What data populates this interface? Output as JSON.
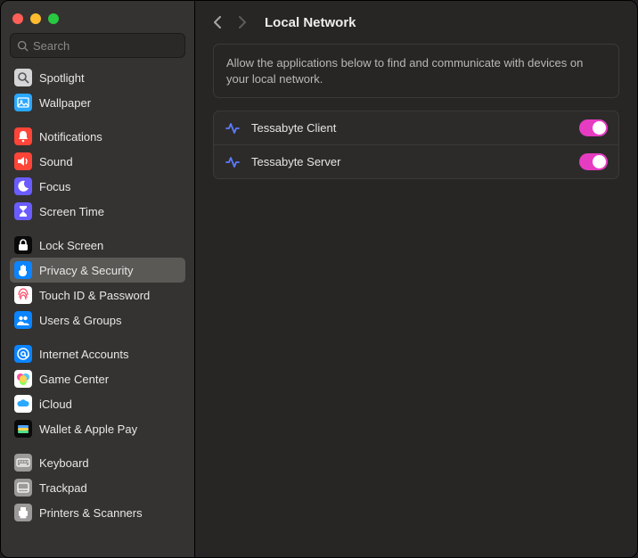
{
  "search": {
    "placeholder": "Search"
  },
  "sidebar": {
    "items": [
      {
        "label": "Spotlight",
        "icon": "spotlight",
        "bg": "#d5d5d8",
        "fg": "#555"
      },
      {
        "label": "Wallpaper",
        "icon": "wallpaper",
        "bg": "#2aa8ff",
        "fg": "#fff"
      },
      {
        "label": "Notifications",
        "icon": "bell",
        "bg": "#ff4438",
        "fg": "#fff"
      },
      {
        "label": "Sound",
        "icon": "sound",
        "bg": "#ff4438",
        "fg": "#fff"
      },
      {
        "label": "Focus",
        "icon": "moon",
        "bg": "#6a5cff",
        "fg": "#fff"
      },
      {
        "label": "Screen Time",
        "icon": "hourglass",
        "bg": "#6a5cff",
        "fg": "#fff"
      },
      {
        "label": "Lock Screen",
        "icon": "lock",
        "bg": "#0a0a0a",
        "fg": "#fff"
      },
      {
        "label": "Privacy & Security",
        "icon": "hand",
        "bg": "#0a84ff",
        "fg": "#fff",
        "selected": true
      },
      {
        "label": "Touch ID & Password",
        "icon": "touchid",
        "bg": "#ffffff",
        "fg": "#ff4765"
      },
      {
        "label": "Users & Groups",
        "icon": "users",
        "bg": "#0a84ff",
        "fg": "#fff"
      },
      {
        "label": "Internet Accounts",
        "icon": "at",
        "bg": "#0a84ff",
        "fg": "#fff"
      },
      {
        "label": "Game Center",
        "icon": "gamecenter",
        "bg": "#ffffff",
        "fg": "#fff"
      },
      {
        "label": "iCloud",
        "icon": "cloud",
        "bg": "#ffffff",
        "fg": "#2aa8ff"
      },
      {
        "label": "Wallet & Apple Pay",
        "icon": "wallet",
        "bg": "#0a0a0a",
        "fg": "#fff"
      },
      {
        "label": "Keyboard",
        "icon": "keyboard",
        "bg": "#9b9a98",
        "fg": "#fff"
      },
      {
        "label": "Trackpad",
        "icon": "trackpad",
        "bg": "#9b9a98",
        "fg": "#fff"
      },
      {
        "label": "Printers & Scanners",
        "icon": "printer",
        "bg": "#9b9a98",
        "fg": "#fff"
      }
    ],
    "groups": [
      [
        0,
        1
      ],
      [
        2,
        3,
        4,
        5
      ],
      [
        6,
        7,
        8,
        9
      ],
      [
        10,
        11,
        12,
        13
      ],
      [
        14,
        15,
        16
      ]
    ]
  },
  "header": {
    "title": "Local Network"
  },
  "info": {
    "text": "Allow the applications below to find and communicate with devices on your local network."
  },
  "apps": [
    {
      "name": "Tessabyte Client",
      "enabled": true
    },
    {
      "name": "Tessabyte Server",
      "enabled": true
    }
  ]
}
